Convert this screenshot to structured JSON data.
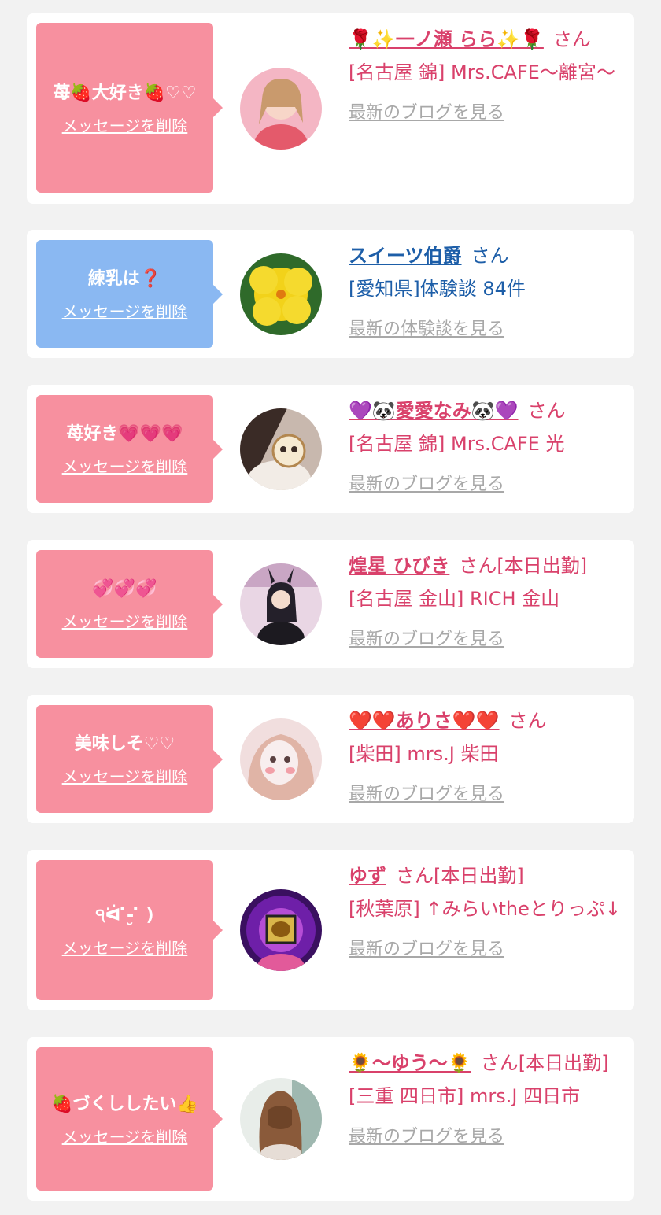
{
  "messages": [
    {
      "text": "苺🍓大好き🍓♡♡",
      "delete_label": "メッセージを削除",
      "name": "🌹✨一ノ瀬 らら✨🌹",
      "honorific": "さん",
      "shop": "[名古屋 錦] Mrs.CAFE～離宮～",
      "latest_label": "最新のブログを見る"
    },
    {
      "text": "練乳は❓",
      "delete_label": "メッセージを削除",
      "name": "スイーツ伯爵",
      "honorific": "さん",
      "shop": "[愛知県]体験談 84件",
      "latest_label": "最新の体験談を見る"
    },
    {
      "text": "苺好き💗💗💗",
      "delete_label": "メッセージを削除",
      "name": "💜🐼愛愛なみ🐼💜",
      "honorific": "さん",
      "shop": "[名古屋 錦] Mrs.CAFE 光",
      "latest_label": "最新のブログを見る"
    },
    {
      "text": "💞💞💞",
      "delete_label": "メッセージを削除",
      "name": "煌星 ひびき",
      "honorific": "さん[本日出勤]",
      "shop": "[名古屋 金山] RICH 金山",
      "latest_label": "最新のブログを見る"
    },
    {
      "text": "美味しそ♡♡",
      "delete_label": "メッセージを削除",
      "name": "❤️❤️ありさ❤️❤️",
      "honorific": "さん",
      "shop": "[柴田] mrs.J 柴田",
      "latest_label": "最新のブログを見る"
    },
    {
      "text": "੧ᐛ ̇-̮ ̇ )",
      "delete_label": "メッセージを削除",
      "name": "ゆず",
      "honorific": "さん[本日出勤]",
      "shop": "[秋葉原] ↑みらいtheとりっぷ↓",
      "latest_label": "最新のブログを見る"
    },
    {
      "text": "🍓づくししたい👍",
      "delete_label": "メッセージを削除",
      "name": "🌻〜ゆう〜🌻",
      "honorific": "さん[本日出勤]",
      "shop": "[三重 四日市] mrs.J 四日市",
      "latest_label": "最新のブログを見る"
    }
  ],
  "colors": {
    "pink_bubble": "#f7909f",
    "blue_bubble": "#8ab8f2",
    "pink_text": "#d9416b",
    "blue_text": "#1d5ea8",
    "link_gray": "#a8a8a8"
  }
}
